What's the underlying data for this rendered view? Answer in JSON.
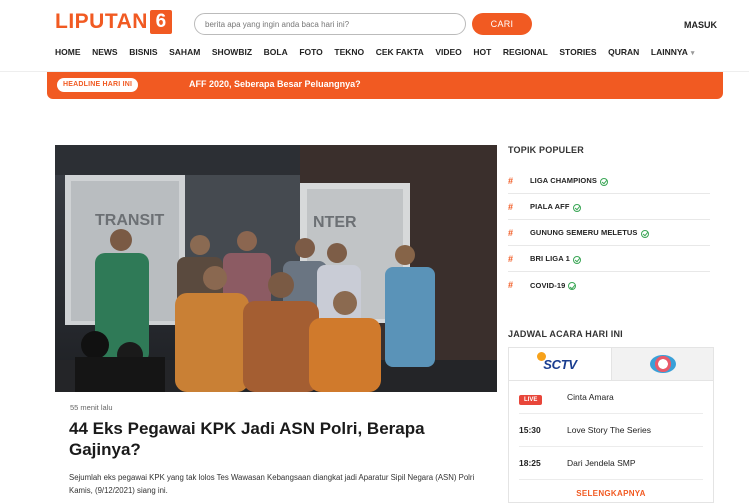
{
  "header": {
    "logo_text": "LIPUTAN",
    "logo_number": "6",
    "search_placeholder": "berita apa yang ingin anda baca hari ini?",
    "search_button": "CARI",
    "login": "MASUK"
  },
  "nav": {
    "items": [
      "HOME",
      "NEWS",
      "BISNIS",
      "SAHAM",
      "SHOWBIZ",
      "BOLA",
      "FOTO",
      "TEKNO",
      "CEK FAKTA",
      "VIDEO",
      "HOT",
      "REGIONAL",
      "STORIES",
      "QURAN",
      "LAINNYA"
    ]
  },
  "headline": {
    "badge": "HEADLINE HARI INI",
    "text": "AFF 2020, Seberapa Besar Peluangnya?"
  },
  "article": {
    "time": "55 menit lalu",
    "title": "44 Eks Pegawai KPK Jadi ASN Polri, Berapa Gajinya?",
    "summary": "Sejumlah eks pegawai KPK yang tak lolos Tes Wawasan Kebangsaan diangkat jadi Aparatur Sipil Negara (ASN) Polri Kamis, (9/12/2021) siang ini.",
    "image_sign_left": "TRANSIT",
    "image_sign_right": "NTER"
  },
  "topik": {
    "title": "TOPIK POPULER",
    "items": [
      "LIGA CHAMPIONS",
      "PIALA AFF",
      "GUNUNG SEMERU MELETUS",
      "BRI LIGA 1",
      "COVID-19"
    ]
  },
  "jadwal": {
    "title": "JADWAL ACARA HARI INI",
    "channel_active": "SCTV",
    "rows": [
      {
        "time": "LIVE",
        "program": "Cinta Amara"
      },
      {
        "time": "15:30",
        "program": "Love Story The Series"
      },
      {
        "time": "18:25",
        "program": "Dari Jendela SMP"
      }
    ],
    "more": "SELENGKAPNYA"
  },
  "colors": {
    "brand": "#f15a22",
    "live": "#e8463a",
    "verified": "#3aa655"
  }
}
